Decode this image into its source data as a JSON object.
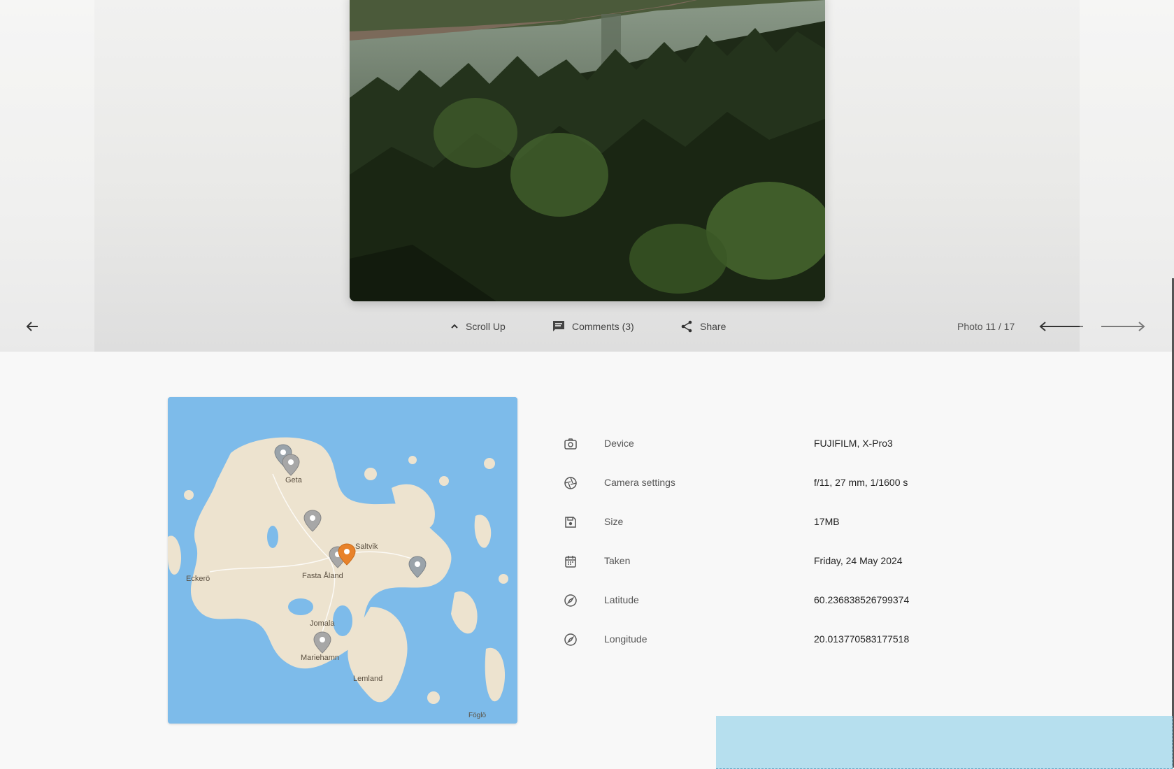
{
  "toolbar": {
    "scroll_up_label": "Scroll Up",
    "comments_label": "Comments (3)",
    "share_label": "Share",
    "counter": "Photo 11 / 17"
  },
  "map": {
    "labels": [
      "Geta",
      "Saltvik",
      "Fasta Åland",
      "Eckerö",
      "Jomala",
      "Mariehamn",
      "Lemland",
      "Föglö"
    ]
  },
  "details": [
    {
      "icon": "camera-icon",
      "label": "Device",
      "value": "FUJIFILM, X-Pro3"
    },
    {
      "icon": "aperture-icon",
      "label": "Camera settings",
      "value": "f/11, 27 mm, 1/1600 s"
    },
    {
      "icon": "save-icon",
      "label": "Size",
      "value": "17MB"
    },
    {
      "icon": "calendar-icon",
      "label": "Taken",
      "value": "Friday, 24 May 2024"
    },
    {
      "icon": "compass-icon",
      "label": "Latitude",
      "value": "60.236838526799374"
    },
    {
      "icon": "compass-icon",
      "label": "Longitude",
      "value": "20.013770583177518"
    }
  ],
  "colors": {
    "accent_pin": "#e8822a",
    "water": "#7dbbea",
    "land": "#ede3cf"
  }
}
